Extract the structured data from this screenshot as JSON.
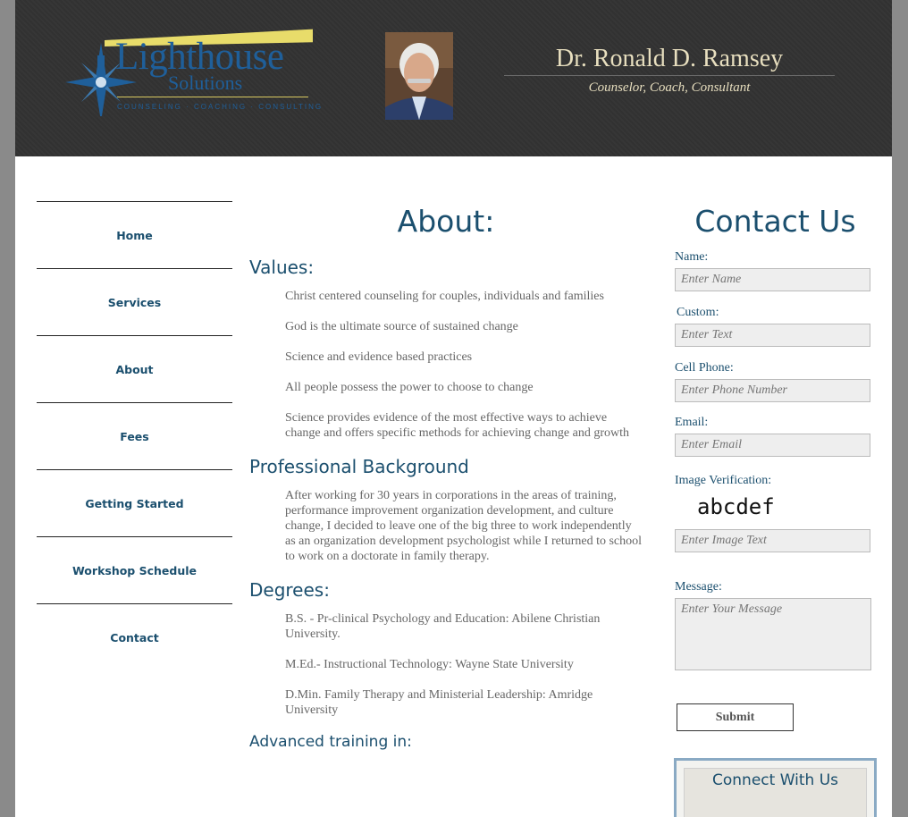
{
  "header": {
    "logo_title": "Lighthouse",
    "logo_subtitle": "Solutions",
    "logo_tagline": "COUNSELING · COACHING · CONSULTING",
    "doctor_name": "Dr. Ronald D. Ramsey",
    "doctor_tagline": "Counselor, Coach, Consultant"
  },
  "nav": {
    "items": [
      "Home",
      "Services",
      "About",
      "Fees",
      "Getting Started",
      "Workshop Schedule",
      "Contact"
    ]
  },
  "main": {
    "title": "About:",
    "values_title": "Values:",
    "values": [
      "Christ centered counseling for couples, individuals and families",
      "God is the ultimate source of sustained change",
      "Science and evidence based practices",
      "All people possess the power to choose to change",
      "Science provides evidence of the most effective ways to achieve change and offers specific methods for achieving change and growth"
    ],
    "background_title": "Professional Background",
    "background_text": "After working for 30 years in corporations in the areas of training, performance improvement organization development, and culture change, I decided to leave one of the big three to work independently as an organization development psychologist while I returned to school to work on a doctorate in family therapy.",
    "degrees_title": "Degrees:",
    "degrees": [
      "B.S. - Pr-clinical Psychology and Education: Abilene Christian University.",
      "M.Ed.- Instructional Technology: Wayne State University",
      "D.Min. Family Therapy and Ministerial Leadership: Amridge University"
    ],
    "advanced_title": "Advanced training in:"
  },
  "contact": {
    "title": "Contact Us",
    "name_label": "Name:",
    "name_placeholder": "Enter Name",
    "custom_label": "Custom:",
    "custom_placeholder": "Enter Text",
    "phone_label": "Cell Phone:",
    "phone_placeholder": "Enter Phone Number",
    "email_label": "Email:",
    "email_placeholder": "Enter Email",
    "verify_label": "Image Verification:",
    "captcha_text": "abcdef",
    "verify_placeholder": "Enter Image Text",
    "message_label": "Message:",
    "message_placeholder": "Enter Your Message",
    "submit_label": "Submit",
    "connect_title": "Connect With Us"
  },
  "colors": {
    "accent": "#1b4f6e",
    "header_bg": "#333333",
    "header_text": "#e8dfbf"
  }
}
